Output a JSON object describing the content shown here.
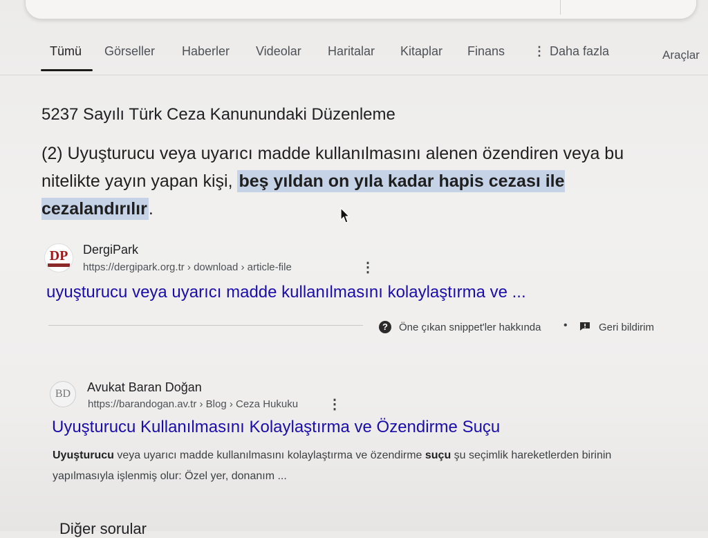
{
  "tabs": [
    {
      "label": "Tümü",
      "active": true
    },
    {
      "label": "Görseller"
    },
    {
      "label": "Haberler"
    },
    {
      "label": "Videolar"
    },
    {
      "label": "Haritalar"
    },
    {
      "label": "Kitaplar"
    },
    {
      "label": "Finans"
    },
    {
      "label": "Daha fazla"
    },
    {
      "label": "Araçlar"
    }
  ],
  "featured": {
    "title": "5237 Sayılı Türk Ceza Kanunundaki Düzenleme",
    "text_before": "(2) Uyuşturucu veya uyarıcı madde kullanılmasını alenen özendiren veya bu nitelikte yayın yapan kişi, ",
    "text_highlight": "beş yıldan on yıla kadar hapis cezası ile cezalandırılır",
    "text_after": ".",
    "source_name": "DergiPark",
    "source_url": "https://dergipark.org.tr › download › article-file",
    "link": "uyuşturucu veya uyarıcı madde kullanılmasını kolaylaştırma ve ...",
    "about_label": "Öne çıkan snippet'ler hakkında",
    "separator": "•",
    "feedback_label": "Geri bildirim"
  },
  "result2": {
    "source_name": "Avukat Baran Doğan",
    "source_url": "https://barandogan.av.tr › Blog › Ceza Hukuku",
    "title": "Uyuşturucu Kullanılmasını Kolaylaştırma ve Özendirme Suçu",
    "desc_b1": "Uyuşturucu",
    "desc_t1": " veya uyarıcı madde kullanılmasını kolaylaştırma ve özendirme ",
    "desc_b2": "suçu",
    "desc_t2": " şu seçimlik hareketlerden birinin yapılmasıyla işlenmiş olur: Özel yer, donanım ..."
  },
  "more_questions": "Diğer sorular",
  "icons": {
    "favicon1": "DP",
    "favicon2": "BD",
    "about": "?",
    "kebab": "⋮"
  }
}
